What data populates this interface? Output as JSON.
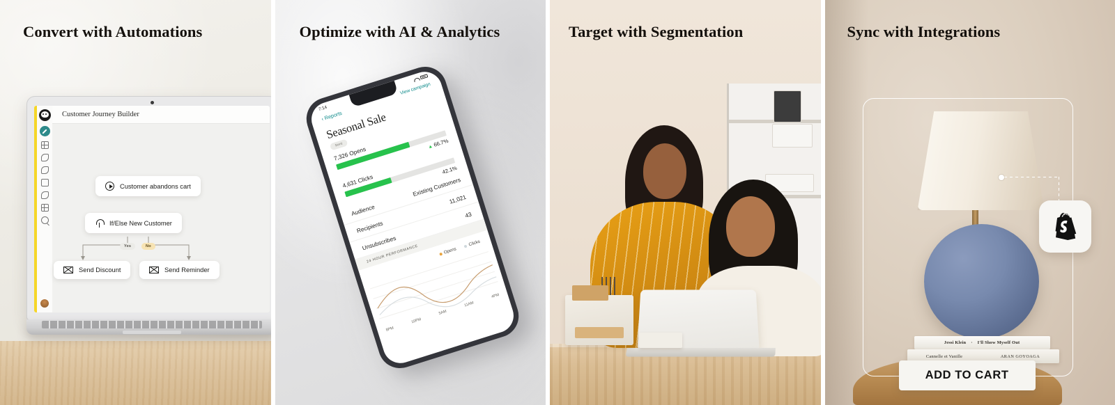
{
  "panels": [
    {
      "id": "automations",
      "title": "Convert with Automations",
      "app": {
        "name": "Mailchimp",
        "screen_title": "Customer Journey Builder",
        "nodes": [
          {
            "label": "Customer abandons cart",
            "icon": "play-icon"
          },
          {
            "label": "If/Else New Customer",
            "icon": "branch-icon"
          },
          {
            "label": "Send Discount",
            "icon": "mail-icon"
          },
          {
            "label": "Send Reminder",
            "icon": "mail-icon"
          }
        ],
        "branch_labels": {
          "yes": "Yes",
          "no": "No"
        },
        "sidebar_icons": [
          "mailchimp-logo-icon",
          "create-pencil-icon",
          "grid-icon",
          "audience-icon",
          "campaign-icon",
          "template-icon",
          "automation-icon",
          "apps-icon",
          "search-icon",
          "user-avatar"
        ],
        "accent": "#f5d628",
        "create_accent": "#2d8a8a"
      }
    },
    {
      "id": "analytics",
      "title": "Optimize with AI & Analytics",
      "app": {
        "status_time": "7:14",
        "back_label": "Reports",
        "campaign_name": "Seasonal Sale",
        "status_badge": "Sent",
        "view_link": "View campaign",
        "metrics": [
          {
            "label": "7,326 Opens",
            "percent": "66.7%",
            "fill": 66.7
          },
          {
            "label": "4,631 Clicks",
            "percent": "42.1%",
            "fill": 42.1
          }
        ],
        "rows": [
          {
            "label": "Audience",
            "value": "Existing Customers"
          },
          {
            "label": "Recipients",
            "value": "11,021"
          },
          {
            "label": "Unsubscribes",
            "value": "43"
          }
        ],
        "section_title": "24 HOUR PERFORMANCE",
        "bar_color": "#27c24c",
        "link_color": "#0d8a8a"
      },
      "chart_data": {
        "type": "line",
        "title": "24 HOUR PERFORMANCE",
        "x": [
          "8PM",
          "10PM",
          "5AM",
          "11AM",
          "4PM"
        ],
        "xlabel": "",
        "ylabel": "",
        "grid": true,
        "legend_position": "top-right",
        "series": [
          {
            "name": "Opens",
            "color": "#e8a33d",
            "values": [
              30,
              62,
              18,
              26,
              58
            ]
          },
          {
            "name": "Clicks",
            "color": "#cfd8dc",
            "values": [
              20,
              40,
              10,
              14,
              34
            ]
          }
        ]
      }
    },
    {
      "id": "segmentation",
      "title": "Target with Segmentation",
      "photo": {
        "description": "Two people reviewing a laptop at a wooden workbench in a small-business stockroom",
        "subjects": [
          "woman-in-yellow-top",
          "woman-in-cream-cardigan"
        ],
        "props": [
          "laptop",
          "desk-organizer",
          "pen-cup",
          "shelving-unit",
          "storage-boxes"
        ]
      }
    },
    {
      "id": "integrations",
      "title": "Sync with Integrations",
      "product": {
        "name": "table-lamp",
        "cta_label": "ADD TO CART",
        "integration_badge": "shopify-icon",
        "books": [
          {
            "author": "Jessi Klein",
            "separator": "·",
            "title": "I'll Show Myself Out"
          },
          {
            "title": "Cannelle et Vanille",
            "author": "ARAN GOYOAGA"
          }
        ]
      }
    }
  ]
}
